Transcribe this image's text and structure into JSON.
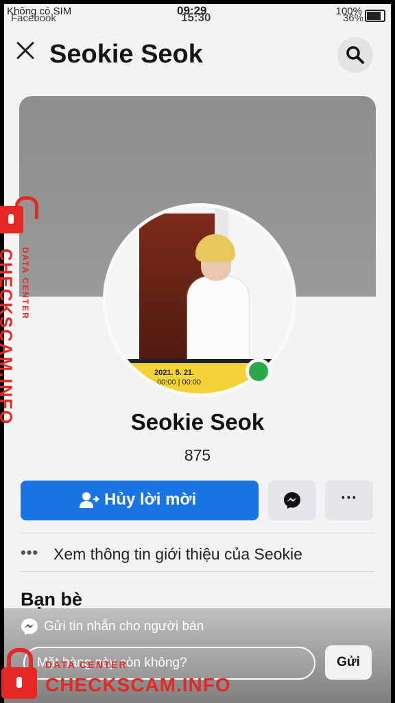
{
  "status_bar": {
    "carrier": "Không có SIM",
    "carrier_app": "Facebook",
    "time": "09:29",
    "time_back": "15:30",
    "battery": "100%",
    "battery_back": "36%"
  },
  "header": {
    "title": "Seokie Seok"
  },
  "profile": {
    "name": "Seokie Seok",
    "friend_count": "875",
    "banner_date": "2021. 5. 21.",
    "banner_time": "00:00 | 00:00"
  },
  "actions": {
    "primary_label": "Hủy lời mời",
    "more_label": "···"
  },
  "intro": {
    "dots": "•••",
    "label": "Xem thông tin giới thiệu của Seokie"
  },
  "friends": {
    "title": "Bạn bè"
  },
  "seller_message": {
    "label": "Gửi tin nhắn cho người bán",
    "input_placeholder": "Mặt hàng này còn không?",
    "send_label": "Gửi"
  },
  "watermark": {
    "brand": "CHECKSCAM.INFO",
    "tagline": "DATA CENTER"
  },
  "colors": {
    "primary": "#1b74e4",
    "online": "#2aa84a",
    "watermark": "#e52823"
  }
}
